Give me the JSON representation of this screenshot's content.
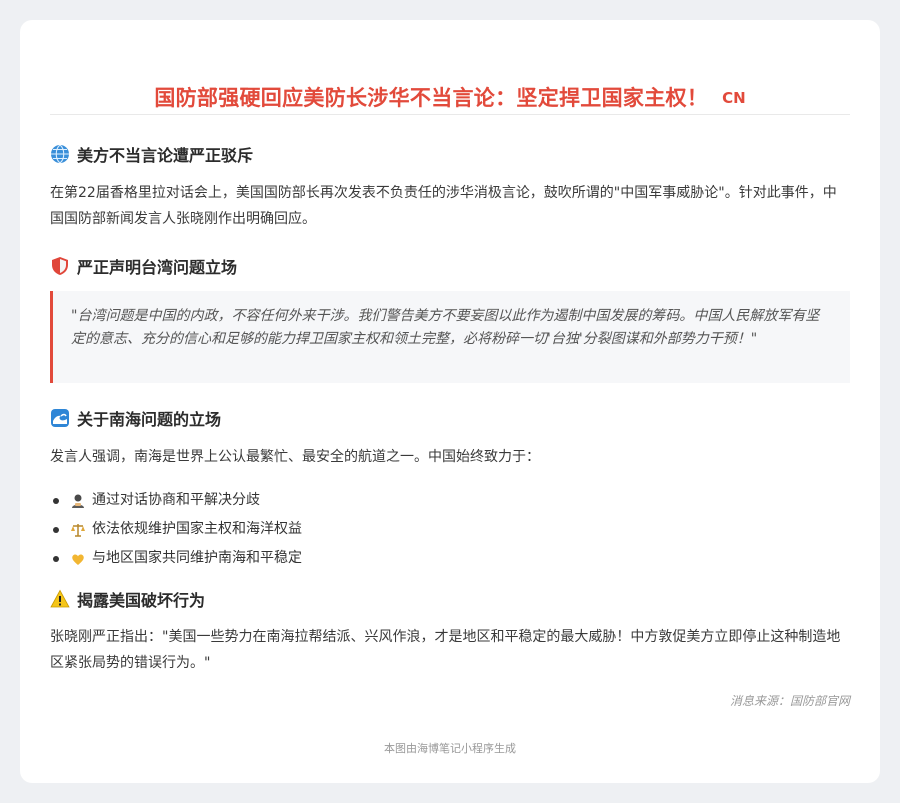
{
  "header": {
    "title": "国防部强硬回应美防长涉华不当言论：坚定捍卫国家主权！",
    "lang_tag": "CN"
  },
  "sections": [
    {
      "icon": "globe-icon",
      "heading": "美方不当言论遭严正驳斥",
      "paragraph": "在第22届香格里拉对话会上，美国国防部长再次发表不负责任的涉华消极言论，鼓吹所谓的\"中国军事威胁论\"。针对此事件，中国国防部新闻发言人张晓刚作出明确回应。"
    },
    {
      "icon": "shield-icon",
      "heading": "严正声明台湾问题立场",
      "quote": "\"台湾问题是中国的内政，不容任何外来干涉。我们警告美方不要妄图以此作为遏制中国发展的筹码。中国人民解放军有坚定的意志、充分的信心和足够的能力捍卫国家主权和领土完整，必将粉碎一切'台独'分裂图谋和外部势力干预！\""
    },
    {
      "icon": "wave-icon",
      "heading": "关于南海问题的立场",
      "paragraph": "发言人强调，南海是世界上公认最繁忙、最安全的航道之一。中国始终致力于：",
      "list": [
        {
          "icon": "handshake-person-icon",
          "text": "通过对话协商和平解决分歧"
        },
        {
          "icon": "scales-icon",
          "text": "依法依规维护国家主权和海洋权益"
        },
        {
          "icon": "heart-hands-icon",
          "text": "与地区国家共同维护南海和平稳定"
        }
      ]
    },
    {
      "icon": "warning-icon",
      "heading": "揭露美国破坏行为",
      "paragraph": "张晓刚严正指出：\"美国一些势力在南海拉帮结派、兴风作浪，才是地区和平稳定的最大威胁！中方敦促美方立即停止这种制造地区紧张局势的错误行为。\""
    }
  ],
  "source": "消息来源：国防部官网",
  "footer": "本图由海博笔记小程序生成",
  "colors": {
    "accent": "#e24a3b",
    "background": "#eef0f3",
    "card": "#ffffff",
    "quote_bg": "#f6f7f9"
  }
}
